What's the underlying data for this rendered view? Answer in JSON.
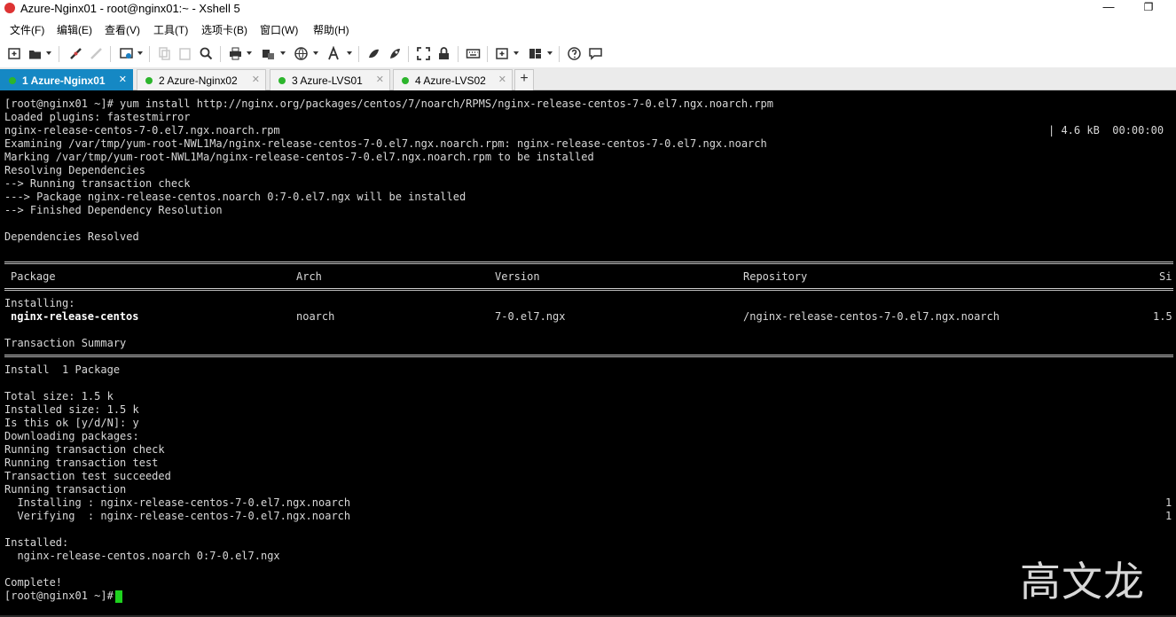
{
  "window": {
    "title": "Azure-Nginx01 - root@nginx01:~ - Xshell 5",
    "minimize": "—",
    "restore": "❐"
  },
  "menu": [
    "文件(F)",
    "编辑(E)",
    "查看(V)",
    "工具(T)",
    "选项卡(B)",
    "窗口(W)",
    "帮助(H)"
  ],
  "toolbar": {
    "icons": [
      "new-session-icon",
      "open-folder-icon",
      "disconnect-icon",
      "reconnect-icon",
      "properties-icon",
      "copy-icon",
      "paste-icon",
      "find-icon",
      "print-icon",
      "transfer-icon",
      "globe-icon",
      "font-icon",
      "xftp-icon",
      "xagent-icon",
      "fullscreen-icon",
      "lock-icon",
      "keyboard-icon",
      "add-tab-icon",
      "layout-icon",
      "help-icon",
      "chat-icon"
    ]
  },
  "tabs": [
    {
      "label": "1 Azure-Nginx01",
      "active": true
    },
    {
      "label": "2 Azure-Nginx02",
      "active": false
    },
    {
      "label": "3 Azure-LVS01",
      "active": false
    },
    {
      "label": "4 Azure-LVS02",
      "active": false
    }
  ],
  "tab_add": "+",
  "tab_close": "✕",
  "terminal": {
    "lines_top": [
      "[root@nginx01 ~]# yum install http://nginx.org/packages/centos/7/noarch/RPMS/nginx-release-centos-7-0.el7.ngx.noarch.rpm",
      "Loaded plugins: fastestmirror",
      "nginx-release-centos-7-0.el7.ngx.noarch.rpm",
      "Examining /var/tmp/yum-root-NWL1Ma/nginx-release-centos-7-0.el7.ngx.noarch.rpm: nginx-release-centos-7-0.el7.ngx.noarch",
      "Marking /var/tmp/yum-root-NWL1Ma/nginx-release-centos-7-0.el7.ngx.noarch.rpm to be installed",
      "Resolving Dependencies",
      "--> Running transaction check",
      "---> Package nginx-release-centos.noarch 0:7-0.el7.ngx will be installed",
      "--> Finished Dependency Resolution",
      "",
      "Dependencies Resolved"
    ],
    "download_progress": "| 4.6 kB  00:00:00",
    "table_headers": {
      "package": "Package",
      "arch": "Arch",
      "version": "Version",
      "repository": "Repository",
      "size": "Si"
    },
    "installing_label": "Installing:",
    "package_row": {
      "name": "nginx-release-centos",
      "arch": "noarch",
      "version": "7-0.el7.ngx",
      "repository": "/nginx-release-centos-7-0.el7.ngx.noarch",
      "size": "1.5"
    },
    "transaction_summary": "Transaction Summary",
    "install_count": "Install  1 Package",
    "lines_bottom": [
      "",
      "Total size: 1.5 k",
      "Installed size: 1.5 k",
      "Is this ok [y/d/N]: y",
      "Downloading packages:",
      "Running transaction check",
      "Running transaction test",
      "Transaction test succeeded",
      "Running transaction",
      "  Installing : nginx-release-centos-7-0.el7.ngx.noarch",
      "  Verifying  : nginx-release-centos-7-0.el7.ngx.noarch",
      "",
      "Installed:",
      "  nginx-release-centos.noarch 0:7-0.el7.ngx",
      "",
      "Complete!",
      "[root@nginx01 ~]# "
    ],
    "step_counts": [
      "1",
      "1"
    ]
  },
  "watermark": "高文龙",
  "colors": {
    "tab_active": "#1588c4",
    "status_dot": "#2cb52c",
    "cursor": "#1ed21e",
    "terminal_bg": "#000000"
  }
}
